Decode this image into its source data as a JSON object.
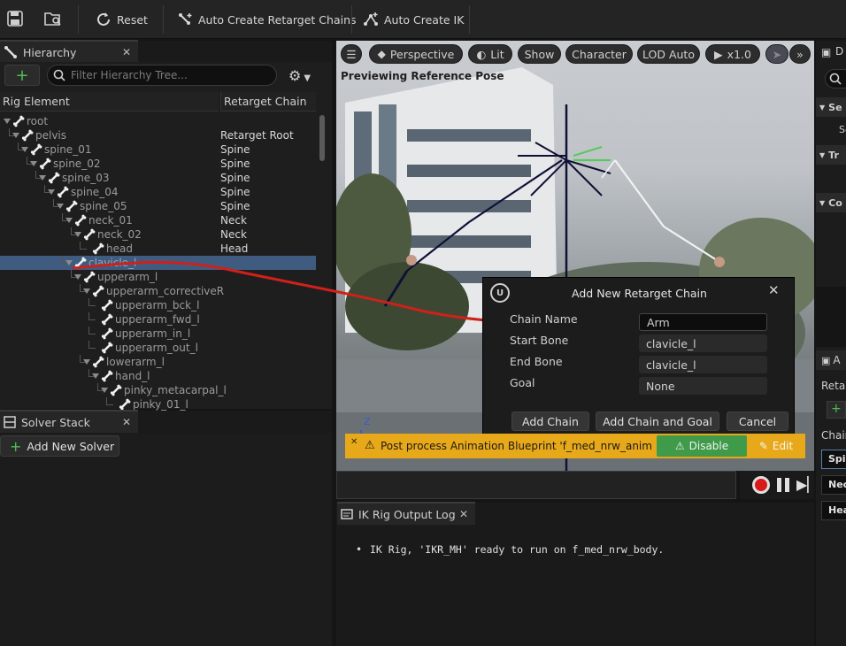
{
  "toolbar": {
    "reset_label": "Reset",
    "auto_chains_label": "Auto Create Retarget Chains",
    "auto_ik_label": "Auto Create IK"
  },
  "hierarchy": {
    "tab_label": "Hierarchy",
    "search_placeholder": "Filter Hierarchy Tree...",
    "col_element": "Rig Element",
    "col_chain": "Retarget Chain",
    "rows": [
      {
        "name": "root",
        "chain": ""
      },
      {
        "name": "pelvis",
        "chain": "Retarget Root"
      },
      {
        "name": "spine_01",
        "chain": "Spine"
      },
      {
        "name": "spine_02",
        "chain": "Spine"
      },
      {
        "name": "spine_03",
        "chain": "Spine"
      },
      {
        "name": "spine_04",
        "chain": "Spine"
      },
      {
        "name": "spine_05",
        "chain": "Spine"
      },
      {
        "name": "neck_01",
        "chain": "Neck"
      },
      {
        "name": "neck_02",
        "chain": "Neck"
      },
      {
        "name": "head",
        "chain": "Head"
      },
      {
        "name": "clavicle_l",
        "chain": ""
      },
      {
        "name": "upperarm_l",
        "chain": ""
      },
      {
        "name": "upperarm_correctiveR",
        "chain": ""
      },
      {
        "name": "upperarm_bck_l",
        "chain": ""
      },
      {
        "name": "upperarm_fwd_l",
        "chain": ""
      },
      {
        "name": "upperarm_in_l",
        "chain": ""
      },
      {
        "name": "upperarm_out_l",
        "chain": ""
      },
      {
        "name": "lowerarm_l",
        "chain": ""
      },
      {
        "name": "hand_l",
        "chain": ""
      },
      {
        "name": "pinky_metacarpal_l",
        "chain": ""
      },
      {
        "name": "pinky_01_l",
        "chain": ""
      }
    ]
  },
  "solver": {
    "tab_label": "Solver Stack",
    "add_label": "Add New Solver"
  },
  "viewport": {
    "perspective": "Perspective",
    "lit": "Lit",
    "show": "Show",
    "character": "Character",
    "lod": "LOD Auto",
    "speed": "x1.0",
    "preview_text": "Previewing Reference Pose",
    "axis_z": "Z"
  },
  "dialog": {
    "title": "Add New Retarget Chain",
    "chain_name_label": "Chain Name",
    "chain_name_value": "Arm",
    "start_bone_label": "Start Bone",
    "start_bone_value": "clavicle_l",
    "end_bone_label": "End Bone",
    "end_bone_value": "clavicle_l",
    "goal_label": "Goal",
    "goal_value": "None",
    "add_chain": "Add Chain",
    "add_chain_goal": "Add Chain and Goal",
    "cancel": "Cancel"
  },
  "warning": {
    "text": "Post process Animation Blueprint 'f_med_nrw_animbp",
    "disable": "Disable",
    "edit": "Edit"
  },
  "log": {
    "tab_label": "IK Rig Output Log",
    "message": "IK Rig, 'IKR_MH' ready to run on f_med_nrw_body."
  },
  "right": {
    "tab_letter": "D",
    "s1": "Se",
    "s2": "Se",
    "t1": "Tr",
    "c1": "Co",
    "retarget_label": "Retar",
    "chain_label": "Chain",
    "chip_spine": "Spi",
    "chip_neck": "Nec",
    "chip_head": "Hea",
    "a_tab": "A"
  },
  "colors": {
    "accent_select": "#3f5c80",
    "warning": "#e7a91a",
    "disable_btn": "#3f9b4a",
    "add_green": "#4fbf4f",
    "arrow_red": "#d0201a"
  }
}
